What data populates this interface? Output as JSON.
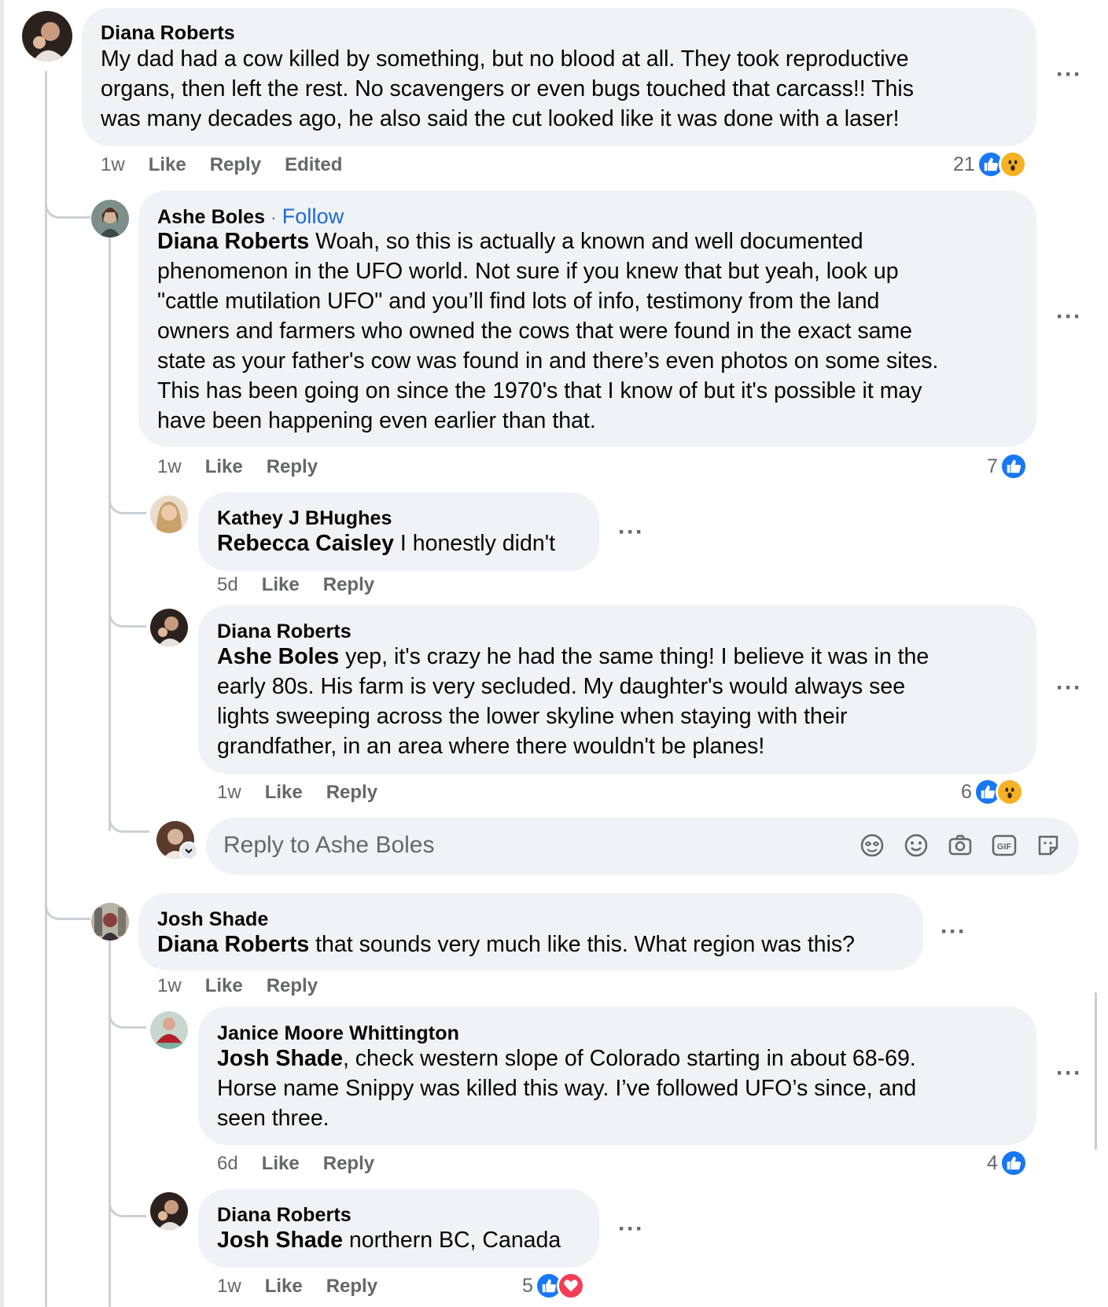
{
  "comments": [
    {
      "author": "Diana Roberts",
      "text": "My dad had a cow killed by something, but no blood at all. They took reproductive organs, then left the rest. No scavengers or even bugs touched that carcass!! This was many decades ago, he also said the cut looked like it was done with a laser!",
      "line1": "My dad had a cow killed by something, but no blood at all. They took reproductive",
      "line2": "organs, then left the rest. No scavengers or even bugs touched that carcass!! This",
      "line3": "was many decades ago, he also said the cut looked like it was done with a laser!",
      "time": "1w",
      "like": "Like",
      "reply": "Reply",
      "edited": "Edited",
      "reaction_count": "21",
      "reactions": [
        "like",
        "wow"
      ]
    },
    {
      "author": "Ashe Boles",
      "follow_sep": "·",
      "follow": "Follow",
      "mention": "Diana Roberts",
      "line1": " Woah, so this is actually a known and well documented",
      "line2": "phenomenon in the UFO world. Not sure if you knew that but yeah, look up",
      "line3": "\"cattle mutilation UFO\" and you’ll find lots of info, testimony from the land",
      "line4": "owners and farmers who owned the cows that were found in the exact same",
      "line5": "state as your father's cow was found in and there’s even photos on some sites.",
      "line6": "This has been going on since the 1970's that I know of but it's possible it may",
      "line7": "have been happening even earlier than that.",
      "time": "1w",
      "like": "Like",
      "reply": "Reply",
      "reaction_count": "7",
      "reactions": [
        "like"
      ]
    },
    {
      "author": "Kathey J BHughes",
      "mention": "Rebecca Caisley",
      "text": " I honestly didn't",
      "time": "5d",
      "like": "Like",
      "reply": "Reply"
    },
    {
      "author": "Diana Roberts",
      "mention": "Ashe Boles",
      "line1": " yep, it's crazy he had the same thing! I believe it was in the",
      "line2": "early 80s. His farm is very secluded. My daughter's would always see",
      "line3": "lights sweeping across the lower skyline when staying with their",
      "line4": "grandfather, in an area where there wouldn't be planes!",
      "time": "1w",
      "like": "Like",
      "reply": "Reply",
      "reaction_count": "6",
      "reactions": [
        "like",
        "wow"
      ]
    },
    {
      "author": "Josh Shade",
      "mention": "Diana Roberts",
      "text": " that sounds very much like this. What region was this?",
      "time": "1w",
      "like": "Like",
      "reply": "Reply"
    },
    {
      "author": "Janice Moore Whittington",
      "mention": "Josh Shade",
      "line1": ", check western slope of Colorado starting in about 68-69.",
      "line2": "Horse name Snippy was killed this way. I’ve followed UFO’s since, and",
      "line3": "seen three.",
      "time": "6d",
      "like": "Like",
      "reply": "Reply",
      "reaction_count": "4",
      "reactions": [
        "like"
      ]
    },
    {
      "author": "Diana Roberts",
      "mention": "Josh Shade",
      "text": " northern BC, Canada",
      "time": "1w",
      "like": "Like",
      "reply": "Reply",
      "reaction_count": "5",
      "reactions": [
        "like",
        "love"
      ]
    }
  ],
  "reply_box": {
    "placeholder": "Reply to Ashe Boles",
    "icons": [
      "avatar-sticker-icon",
      "emoji-icon",
      "camera-icon",
      "gif-icon",
      "sticker-icon"
    ]
  },
  "more_label": "···",
  "colors": {
    "bubble": "#f0f2f5",
    "secondary_text": "#65676b",
    "link_blue": "#1b6ad3",
    "like_blue": "#1877f2",
    "wow_yellow": "#f7b125",
    "love_red": "#f33e58"
  }
}
